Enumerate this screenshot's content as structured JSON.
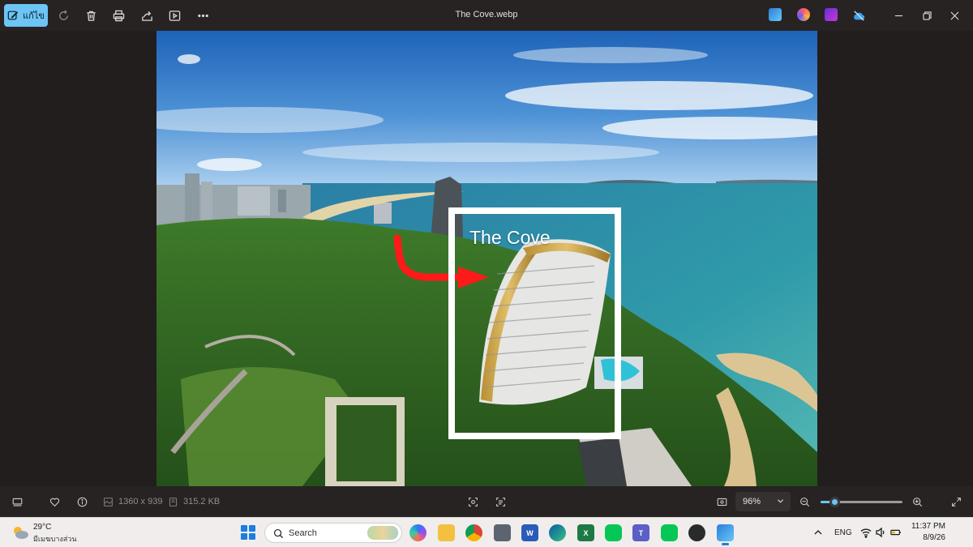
{
  "window": {
    "title": "The Cove.webp"
  },
  "toolbar": {
    "edit_label": "แก้ไข",
    "icons": [
      "edit-icon",
      "rotate-icon",
      "trash-icon",
      "print-icon",
      "share-icon",
      "slideshow-icon",
      "more-icon"
    ]
  },
  "photo": {
    "annotation_text": "The Cove",
    "colors": {
      "frame": "#ffffff",
      "arrow": "#ff1a1a"
    }
  },
  "statusbar": {
    "dimensions": "1360 x 939",
    "file_size": "315.2 KB",
    "zoom_value": "96%",
    "zoom_fraction": 0.17
  },
  "taskbar": {
    "weather": {
      "temperature": "29°C",
      "condition": "มีเมฆบางส่วน"
    },
    "search_placeholder": "Search",
    "language": "ENG",
    "time": "11:37 PM",
    "date": "8/9/26"
  },
  "accent_color": "#6cc5f5"
}
